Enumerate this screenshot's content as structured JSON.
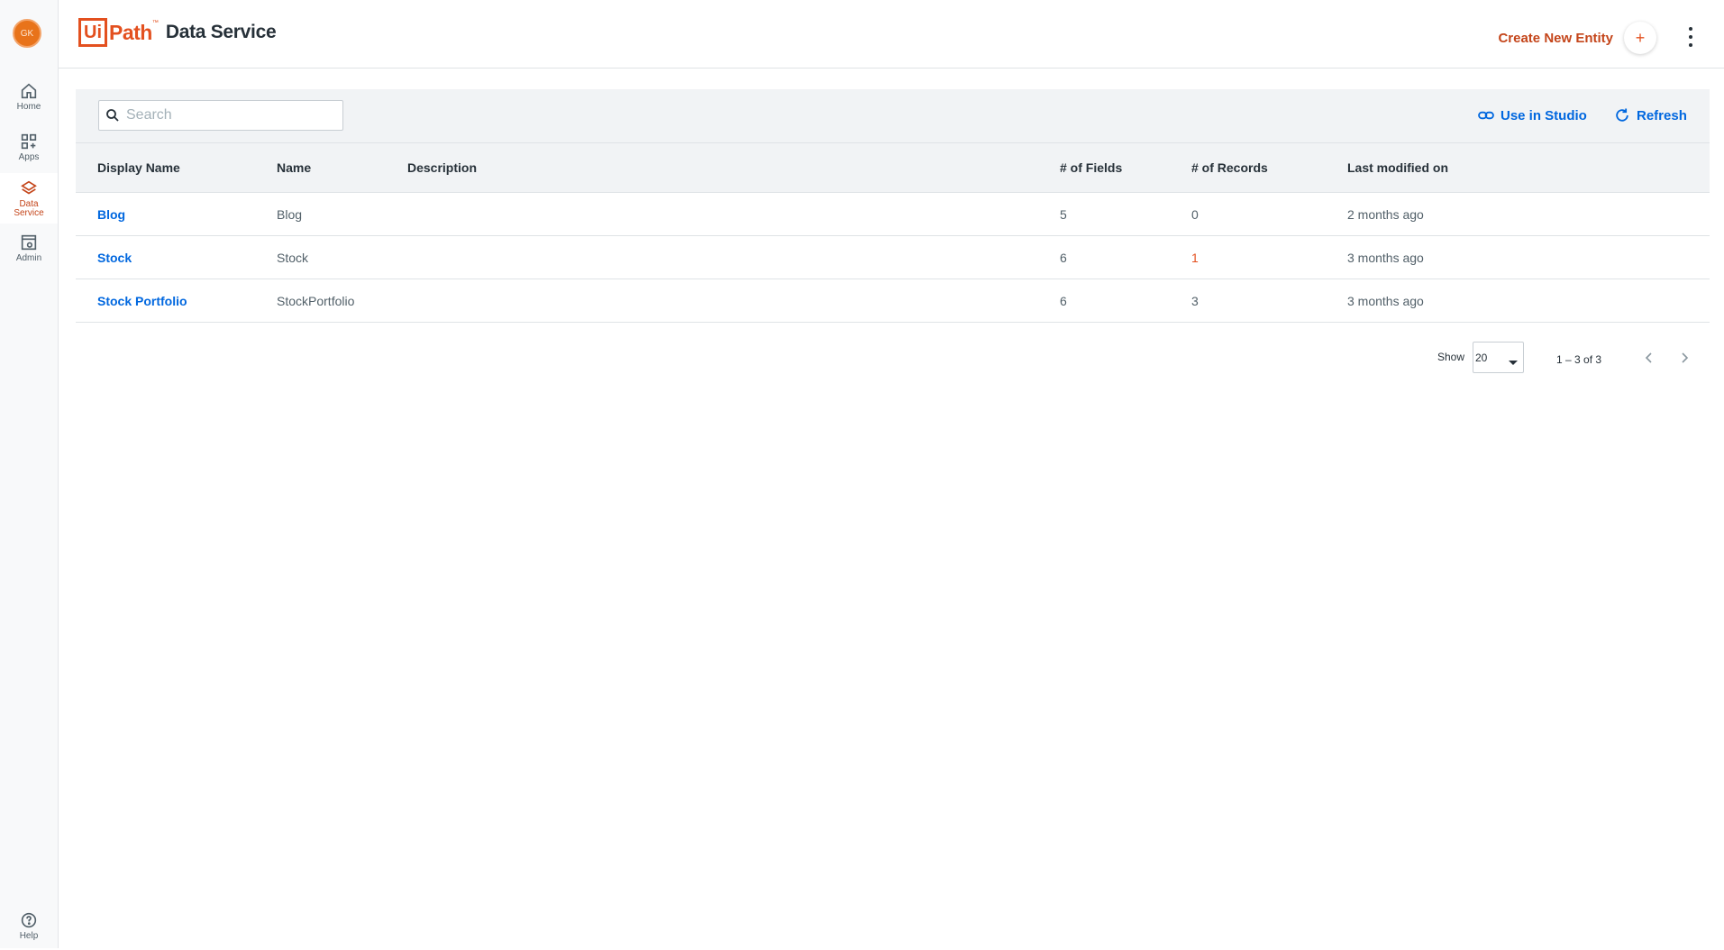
{
  "rail": {
    "avatar_initials": "GK",
    "items": [
      {
        "label": "Home",
        "icon": "home-icon"
      },
      {
        "label": "Apps",
        "icon": "apps-icon"
      },
      {
        "label": "Data Service",
        "icon": "layers-icon"
      },
      {
        "label": "Admin",
        "icon": "admin-icon"
      }
    ],
    "help_label": "Help"
  },
  "header": {
    "logo_ui": "Ui",
    "logo_path": "Path",
    "logo_tm": "™",
    "product": "Data Service",
    "create_label": "Create New Entity",
    "create_plus": "+"
  },
  "toolbar": {
    "search_placeholder": "Search",
    "use_in_studio": "Use in Studio",
    "refresh": "Refresh"
  },
  "table": {
    "columns": [
      "Display Name",
      "Name",
      "Description",
      "# of Fields",
      "# of Records",
      "Last modified on"
    ],
    "rows": [
      {
        "display_name": "Blog",
        "name": "Blog",
        "description": "",
        "fields": "5",
        "records": "0",
        "modified": "2 months ago"
      },
      {
        "display_name": "Stock",
        "name": "Stock",
        "description": "",
        "fields": "6",
        "records": "1",
        "modified": "3 months ago"
      },
      {
        "display_name": "Stock Portfolio",
        "name": "StockPortfolio",
        "description": "",
        "fields": "6",
        "records": "3",
        "modified": "3 months ago"
      }
    ]
  },
  "pager": {
    "show_label": "Show",
    "page_size": "20",
    "range": "1 – 3 of 3"
  },
  "colors": {
    "brand_orange": "#e3501f",
    "link_blue": "#0067df",
    "text": "#273139"
  }
}
